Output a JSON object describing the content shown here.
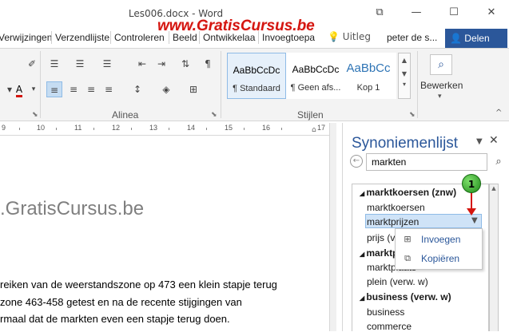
{
  "window": {
    "title": "Les006.docx - Word",
    "watermark": "www.GratisCursus.be",
    "restore_label": "⧉",
    "minimize_label": "—",
    "maximize_label": "☐",
    "close_label": "✕"
  },
  "tabs": [
    "Verwijzingen",
    "Verzendlijste",
    "Controleren",
    "Beeld",
    "Ontwikkelaa",
    "Invoegtoepa"
  ],
  "tell_me": "Uitleg",
  "user_name": "peter de s...",
  "share_label": "Delen",
  "ribbon": {
    "group_paragraph": "Alinea",
    "group_styles": "Stijlen",
    "editing_label": "Bewerken",
    "styles": [
      {
        "sample": "AaBbCcDc",
        "name": "¶ Standaard"
      },
      {
        "sample": "AaBbCcDc",
        "name": "¶ Geen afs..."
      },
      {
        "sample": "AaBbCc",
        "name": "Kop 1"
      }
    ]
  },
  "ruler_numbers": [
    "9",
    "10",
    "11",
    "12",
    "13",
    "14",
    "15",
    "16",
    "17"
  ],
  "document": {
    "heading": ".GratisCursus.be",
    "lines": [
      "reiken van de weerstandszone op 473 een klein stapje terug",
      "zone 463-458 getest en na de recente stijgingen van",
      "rmaal dat de markten even een stapje terug doen."
    ]
  },
  "thesaurus": {
    "title": "Synoniemenlijst",
    "search_value": "markten",
    "items": [
      {
        "type": "head",
        "text": "marktkoersen (znw)"
      },
      {
        "type": "item",
        "text": "marktkoersen"
      },
      {
        "type": "item",
        "text": "marktprijzen",
        "selected": true
      },
      {
        "type": "item",
        "text": "prijs (v"
      },
      {
        "type": "head",
        "text": "marktp"
      },
      {
        "type": "item",
        "text": "marktplaats"
      },
      {
        "type": "item",
        "text": "plein (verw. w)"
      },
      {
        "type": "head",
        "text": "business (verw. w)"
      },
      {
        "type": "item",
        "text": "business"
      },
      {
        "type": "item",
        "text": "commerce"
      }
    ],
    "context_menu": [
      {
        "label": "Invoegen",
        "icon": "insert-icon"
      },
      {
        "label": "Kopiëren",
        "icon": "copy-icon"
      }
    ],
    "step_badge": "1"
  },
  "colors": {
    "accent": "#2b579a",
    "watermark": "#d4150f",
    "badge": "#3cb52f",
    "selection": "#cfe3f7"
  }
}
